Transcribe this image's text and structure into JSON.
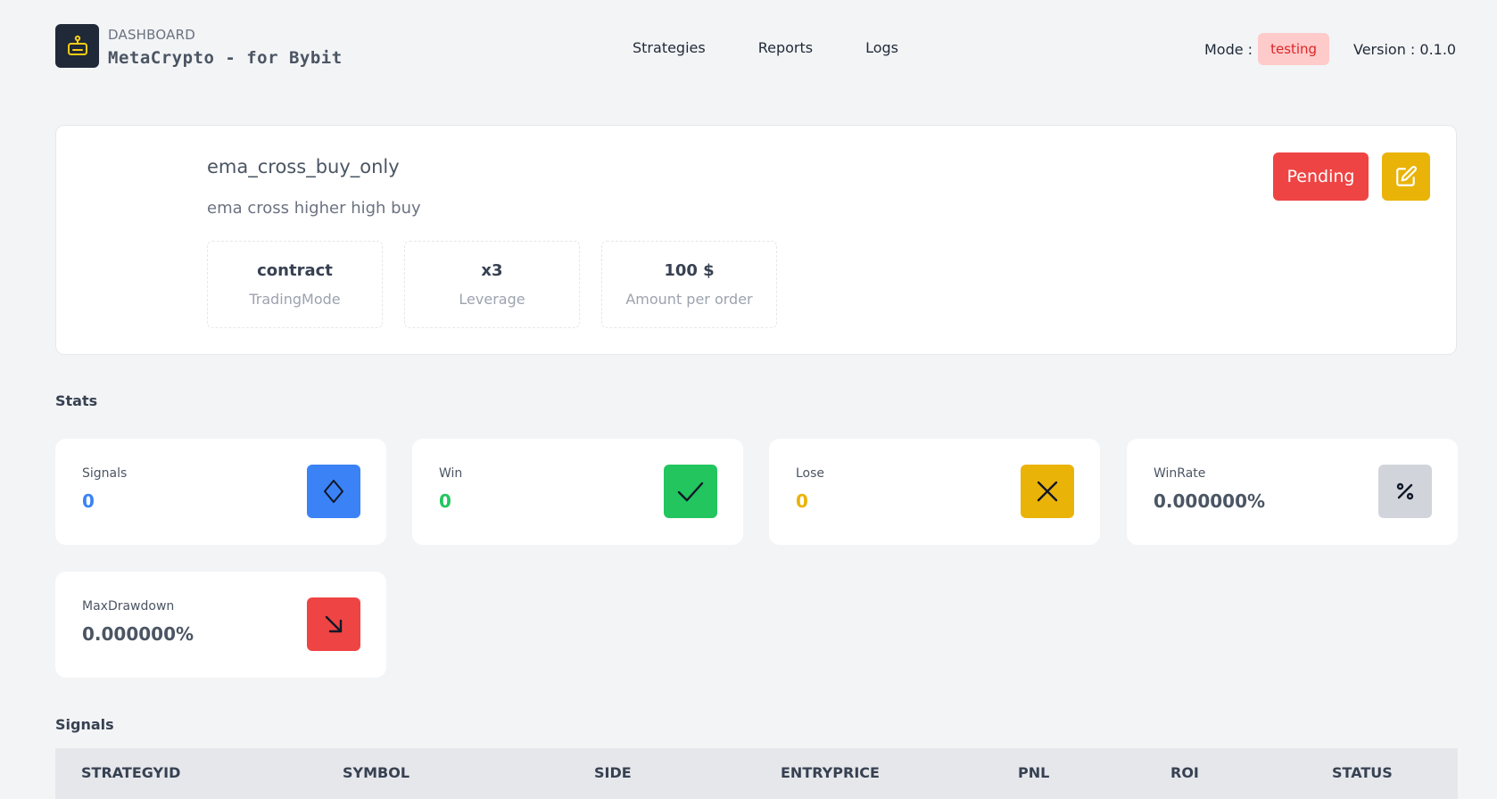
{
  "header": {
    "brand_sub": "DASHBOARD",
    "brand_title": "MetaCrypto - for Bybit",
    "nav": [
      {
        "label": "Strategies"
      },
      {
        "label": "Reports"
      },
      {
        "label": "Logs"
      }
    ],
    "mode_label": "Mode :",
    "mode_value": "testing",
    "version_label": "Version : 0.1.0"
  },
  "strategy": {
    "name": "ema_cross_buy_only",
    "description": "ema cross higher high buy",
    "info": [
      {
        "value": "contract",
        "label": "TradingMode"
      },
      {
        "value": "x3",
        "label": "Leverage"
      },
      {
        "value": "100 $",
        "label": "Amount per order"
      }
    ],
    "status_button": "Pending"
  },
  "stats": {
    "title": "Stats",
    "cards": [
      {
        "label": "Signals",
        "value": "0",
        "icon": "chevron-up-down-icon",
        "color": "#3b82f6",
        "value_color": "#3b82f6"
      },
      {
        "label": "Win",
        "value": "0",
        "icon": "check-icon",
        "color": "#22c55e",
        "value_color": "#22c55e"
      },
      {
        "label": "Lose",
        "value": "0",
        "icon": "x-icon",
        "color": "#eab308",
        "value_color": "#eab308"
      },
      {
        "label": "WinRate",
        "value": "0.000000%",
        "icon": "percent-icon",
        "color": "#d1d5db",
        "value_color": "#4b5563"
      },
      {
        "label": "MaxDrawdown",
        "value": "0.000000%",
        "icon": "arrow-down-right-icon",
        "color": "#ef4444",
        "value_color": "#4b5563"
      }
    ]
  },
  "signals": {
    "title": "Signals",
    "columns": [
      "STRATEGYID",
      "SYMBOL",
      "SIDE",
      "ENTRYPRICE",
      "PNL",
      "ROI",
      "STATUS"
    ]
  },
  "colors": {
    "background": "#f3f4f6",
    "pending": "#ef4444",
    "edit": "#eab308",
    "mode_badge_bg": "#fecaca",
    "mode_badge_text": "#dc2626"
  }
}
